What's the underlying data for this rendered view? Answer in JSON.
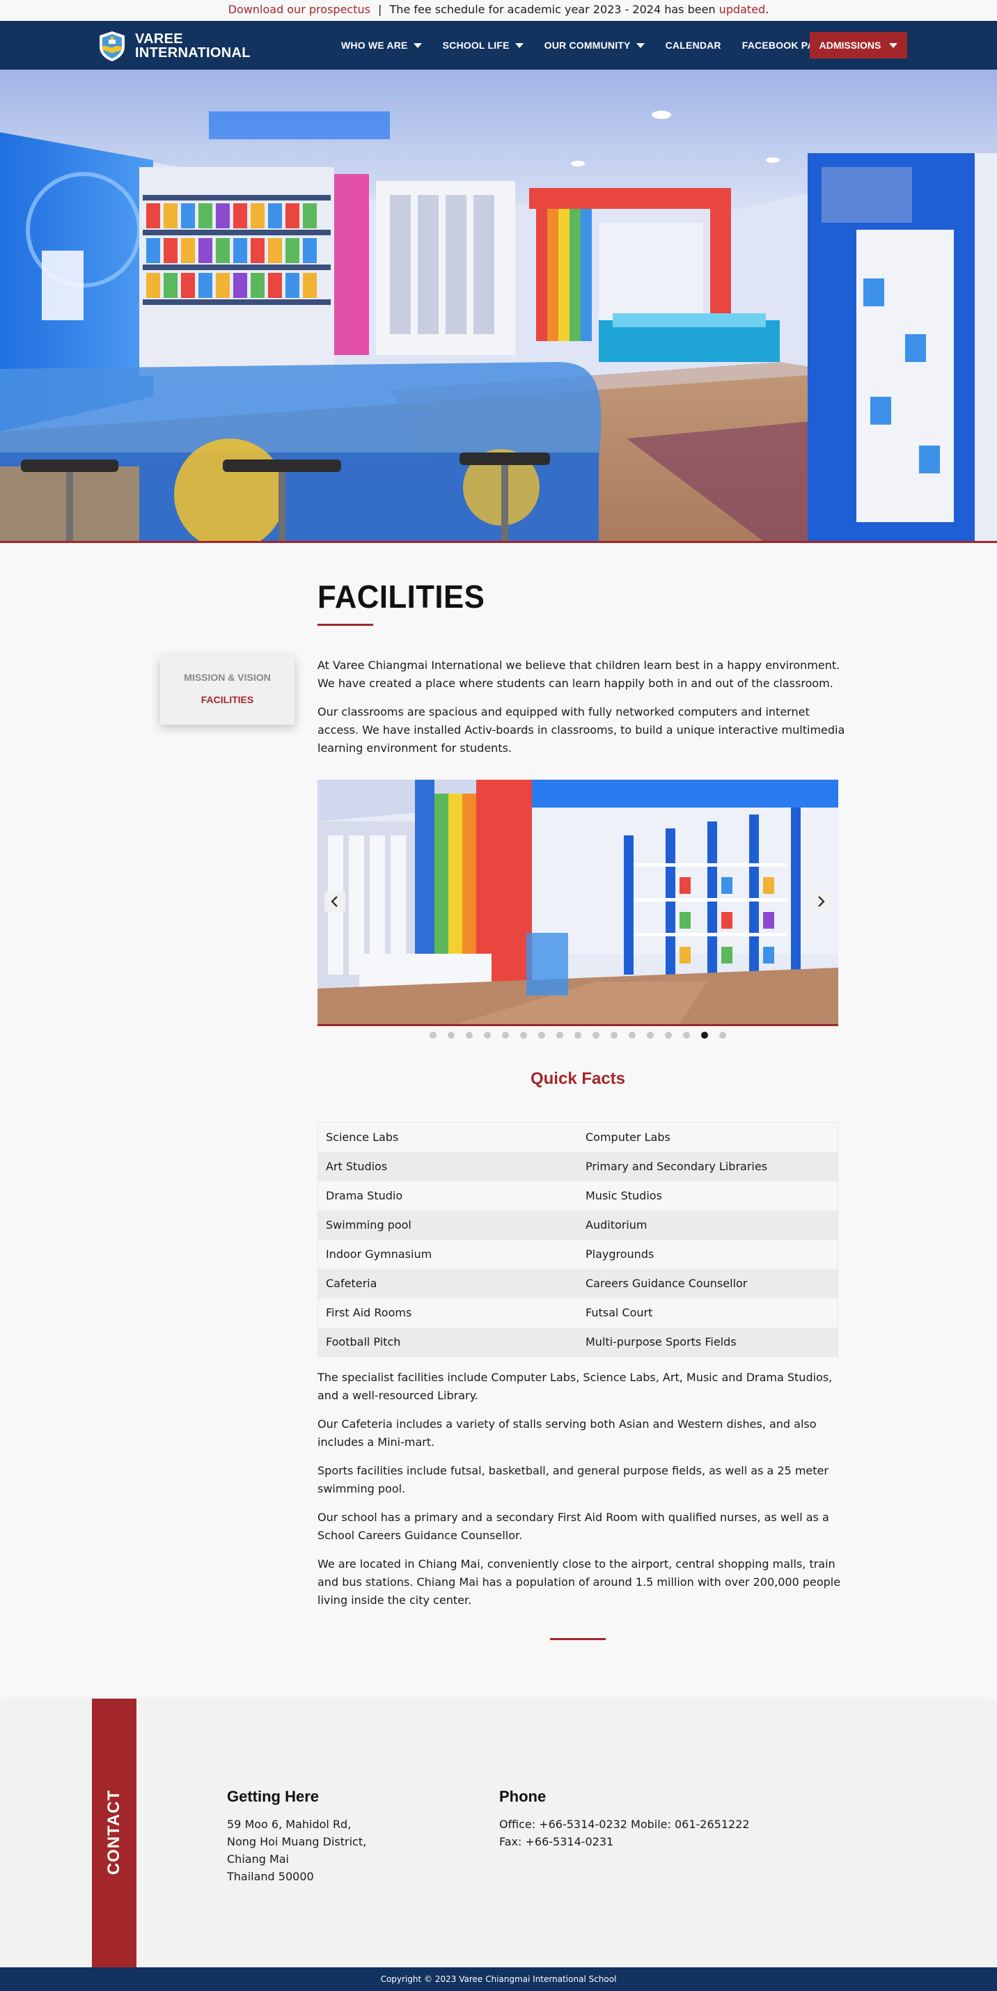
{
  "announcement": {
    "link_text": "Download our prospectus",
    "separator": "|",
    "message": "The fee schedule for academic year 2023 - 2024 has been",
    "updated_link": "updated",
    "period": "."
  },
  "header": {
    "logo_line1": "VAREE",
    "logo_line2": "INTERNATIONAL",
    "nav": [
      {
        "label": "WHO WE ARE",
        "dropdown": true
      },
      {
        "label": "SCHOOL LIFE",
        "dropdown": true
      },
      {
        "label": "OUR COMMUNITY",
        "dropdown": true
      },
      {
        "label": "CALENDAR",
        "dropdown": false
      },
      {
        "label": "FACEBOOK PAGE",
        "dropdown": false
      }
    ],
    "admissions_label": "ADMISSIONS"
  },
  "sidenav": {
    "items": [
      "MISSION & VISION",
      "FACILITIES"
    ],
    "active": "FACILITIES"
  },
  "main": {
    "title": "FACILITIES",
    "intro": [
      "At Varee Chiangmai International we believe that children learn best in a happy environment. We have created a place where students can learn happily both in and out of the classroom.",
      "Our classrooms are spacious and equipped with fully networked computers and internet access. We have installed Activ-boards in classrooms, to build a unique interactive multimedia learning environment for students."
    ],
    "slider": {
      "dot_count": 17,
      "active_index": 15
    },
    "quick_facts_title": "Quick Facts",
    "quick_facts": [
      [
        "Science Labs",
        "Computer Labs"
      ],
      [
        "Art Studios",
        "Primary and Secondary Libraries"
      ],
      [
        "Drama Studio",
        "Music Studios"
      ],
      [
        "Swimming pool",
        "Auditorium"
      ],
      [
        "Indoor Gymnasium",
        "Playgrounds"
      ],
      [
        "Cafeteria",
        "Careers Guidance Counsellor"
      ],
      [
        "First Aid Rooms",
        "Futsal Court"
      ],
      [
        "Football Pitch",
        "Multi-purpose Sports Fields"
      ]
    ],
    "details": [
      "The specialist facilities include Computer Labs, Science Labs, Art, Music and Drama Studios, and a well-resourced Library.",
      "Our Cafeteria includes a variety of stalls serving both Asian and Western dishes, and also includes a Mini-mart.",
      "Sports facilities include futsal, basketball, and general purpose fields, as well as a 25 meter swimming pool.",
      "Our school has a primary and a secondary First Aid Room with qualified nurses, as well as a School Careers Guidance Counsellor.",
      "We are located in Chiang Mai, conveniently close to the airport, central shopping malls, train and bus stations. Chiang Mai has a population of around 1.5 million with over 200,000 people living inside the city center."
    ]
  },
  "footer": {
    "contact_label": "CONTACT",
    "getting_here": {
      "title": "Getting Here",
      "lines": [
        "59 Moo 6, Mahidol Rd,",
        "Nong Hoi Muang District,",
        "Chiang Mai",
        "Thailand 50000"
      ]
    },
    "phone": {
      "title": "Phone",
      "lines": [
        "Office: +66-5314-0232 Mobile: 061-2651222",
        "Fax: +66-5314-0231"
      ]
    },
    "copyright": "Copyright © 2023 Varee Chiangmai International School"
  },
  "colors": {
    "brand_navy": "#12325f",
    "brand_red": "#a3272a"
  }
}
